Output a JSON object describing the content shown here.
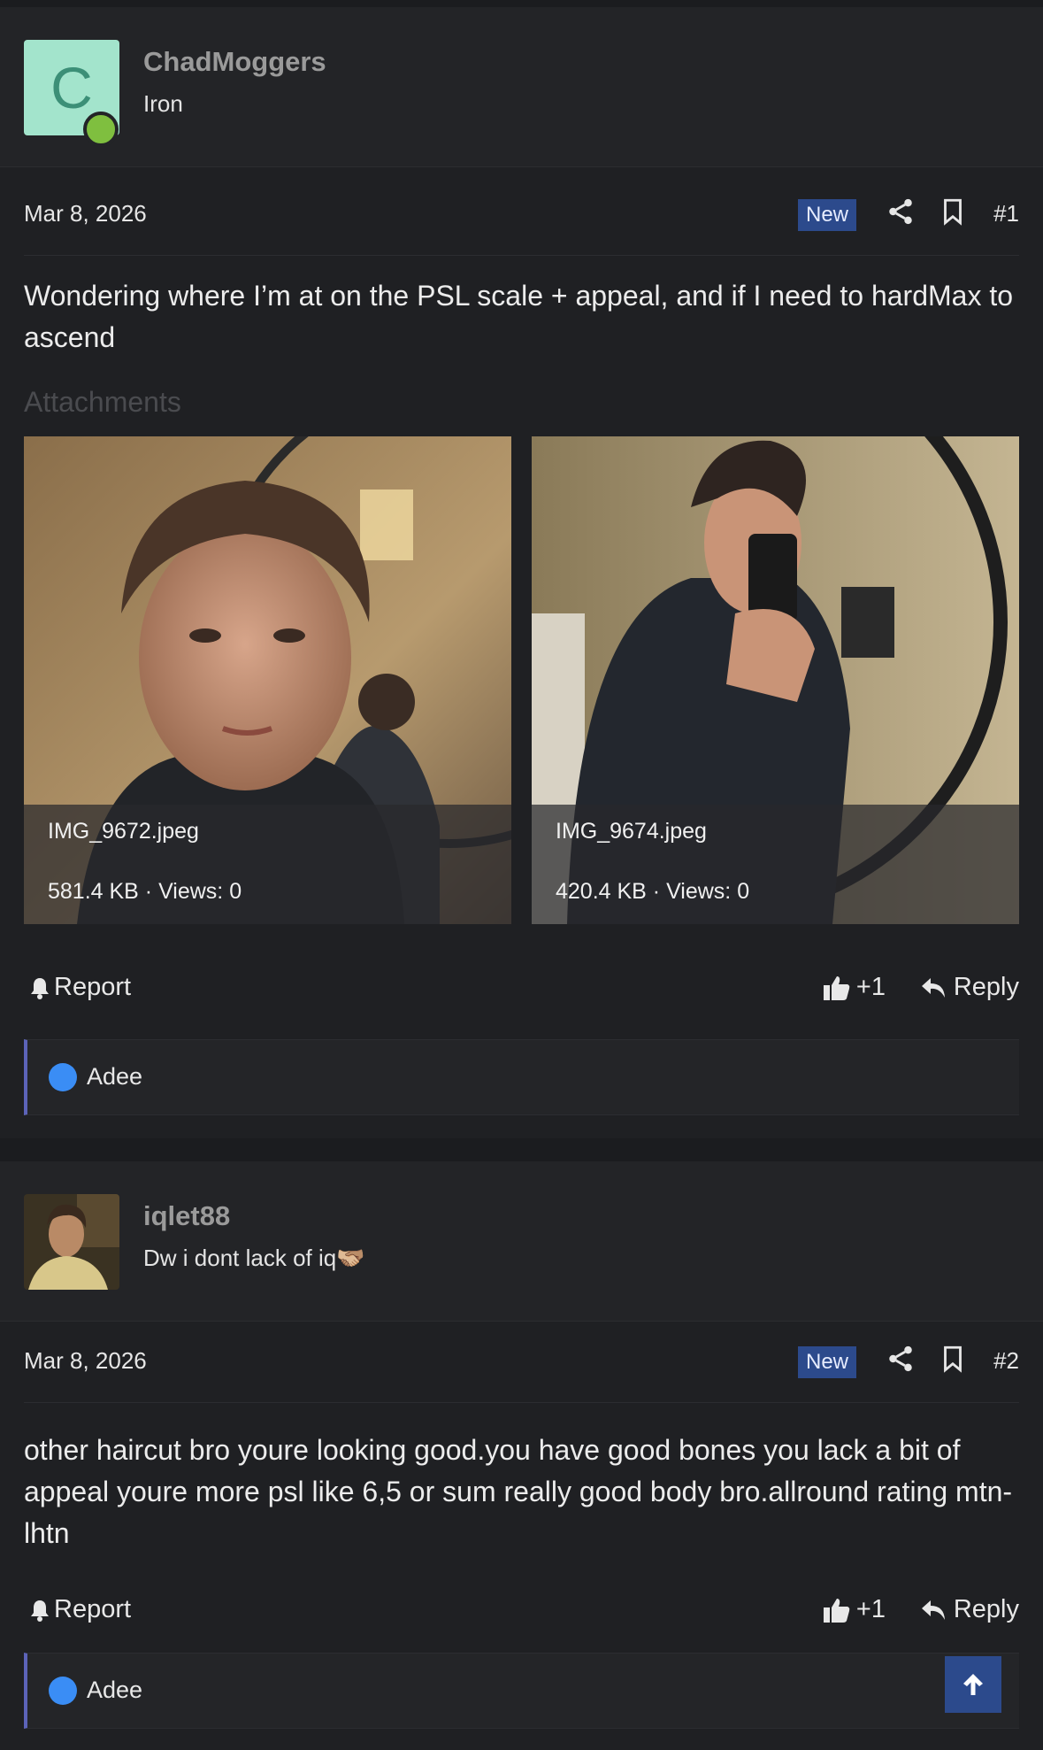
{
  "posts": [
    {
      "username": "ChadMoggers",
      "user_title": "Iron",
      "avatar_letter": "C",
      "date": "Mar 8, 2026",
      "badge": "New",
      "post_number": "#1",
      "body": "Wondering where I’m at on the PSL scale + appeal, and if I need to hardMax to ascend",
      "attachments_label": "Attachments",
      "attachments": [
        {
          "filename": "IMG_9672.jpeg",
          "info": "581.4 KB · Views: 0"
        },
        {
          "filename": "IMG_9674.jpeg",
          "info": "420.4 KB · Views: 0"
        }
      ],
      "report_label": "Report",
      "like_count": "+1",
      "reply_label": "Reply",
      "reaction_user": "Adee"
    },
    {
      "username": "iqlet88",
      "user_title": "Dw i dont lack of iq🫱🏼‍🫲🏽",
      "date": "Mar 8, 2026",
      "badge": "New",
      "post_number": "#2",
      "body": "other haircut bro youre looking good.you have good bones you lack a bit of appeal youre more psl like 6,5 or sum really good body bro.allround rating mtn-lhtn",
      "report_label": "Report",
      "like_count": "+1",
      "reply_label": "Reply",
      "reaction_user": "Adee"
    }
  ],
  "colors": {
    "background": "#1f2023",
    "accent": "#2c4a8c",
    "online": "#7fbf3f",
    "reaction_border": "#5c63b8"
  }
}
